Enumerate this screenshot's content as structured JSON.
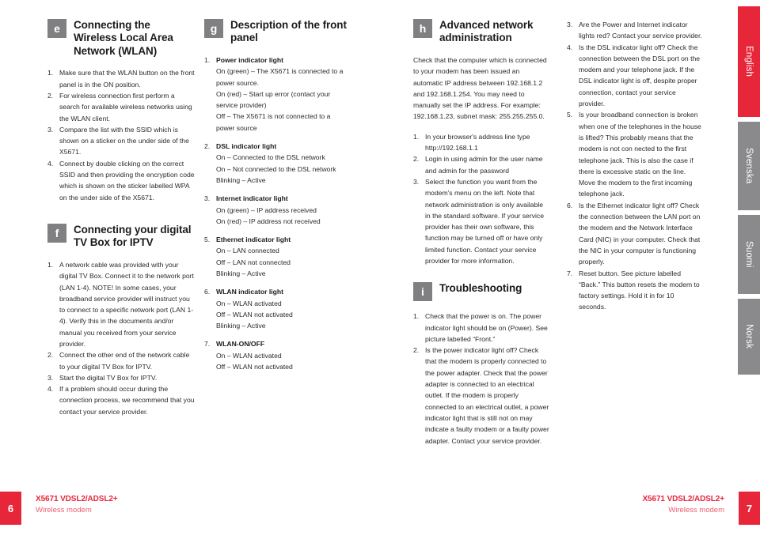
{
  "document": {
    "product": "X5671 VDSL2/ADSL2+",
    "product_subtitle": "Wireless modem",
    "accent_red": "#e8263a",
    "badge_gray": "#808083"
  },
  "language_tabs": [
    {
      "label": "English",
      "active": true
    },
    {
      "label": "Svenska",
      "active": false
    },
    {
      "label": "Suomi",
      "active": false
    },
    {
      "label": "Norsk",
      "active": false
    }
  ],
  "footer_left": {
    "page": "6",
    "product": "X5671 VDSL2/ADSL2+",
    "subtitle": "Wireless modem"
  },
  "footer_right": {
    "page": "7",
    "product": "X5671 VDSL2/ADSL2+",
    "subtitle": "Wireless modem"
  },
  "column1": {
    "section_e": {
      "badge": "e",
      "title": "Connecting the Wireless Local Area Network (WLAN)",
      "items": [
        {
          "num": "1.",
          "text": "Make sure that the WLAN button on the front panel is in the ON position."
        },
        {
          "num": "2.",
          "text": "For wireless connection first perform a search for available wireless networks using the WLAN client."
        },
        {
          "num": "3.",
          "text": "Compare the list with the SSID which is shown on a sticker on the under side of the X5671."
        },
        {
          "num": "4.",
          "text": "Connect by double clicking on the correct SSID and then providing the encryption code which is shown on the sticker labelled WPA on the under side of the X5671."
        }
      ]
    },
    "section_f": {
      "badge": "f",
      "title": "Connecting your digital TV Box for IPTV",
      "items": [
        {
          "num": "1.",
          "text": "A network cable was provided with your digital TV Box. Connect it to the network port (LAN 1-4). NOTE! In some cases, your broadband service provider will instruct you to connect to a specific network port (LAN 1-4). Verify this in the documents and/or manual you received from your service provider."
        },
        {
          "num": "2.",
          "text": "Connect the other end of the network cable to your digital TV Box for IPTV."
        },
        {
          "num": "3.",
          "text": "Start the digital TV Box for IPTV."
        },
        {
          "num": "4.",
          "text": "If a problem should occur during the connection process, we recommend that you contact your service provider."
        }
      ]
    }
  },
  "column2": {
    "section_g": {
      "badge": "g",
      "title": "Description of the front panel",
      "items": [
        {
          "num": "1.",
          "title": "Power indicator light",
          "lines": [
            "On (green) – The X5671 is connected to a power source.",
            "On (red) – Start up error (contact your service provider)",
            "Off – The X5671 is not connected to a power source"
          ]
        },
        {
          "num": "2.",
          "title": "DSL indicator light",
          "lines": [
            "On – Connected to the DSL network",
            "On – Not connected to the DSL network",
            "Blinking – Active"
          ]
        },
        {
          "num": "3.",
          "title": "Internet indicator light",
          "lines": [
            "On (green) – IP address received",
            "On (red) – IP address not received"
          ]
        },
        {
          "num": "5.",
          "title": "Ethernet indicator light",
          "lines": [
            "On – LAN connected",
            "Off – LAN not connected",
            "Blinking – Active"
          ]
        },
        {
          "num": "6.",
          "title": "WLAN indicator light",
          "lines": [
            "On – WLAN activated",
            "Off – WLAN not activated",
            "Blinking – Active"
          ]
        },
        {
          "num": "7.",
          "title": "WLAN-ON/OFF",
          "lines": [
            "On – WLAN activated",
            "Off – WLAN not activated"
          ]
        }
      ]
    }
  },
  "column3": {
    "section_h": {
      "badge": "h",
      "title": "Advanced network administration",
      "intro": "Check that the computer which is connected to your modem has been issued an automatic IP address between 192.168.1.2 and 192.168.1.254. You may need to manually set the IP address. For example: 192.168.1.23, subnet mask: 255.255.255.0.",
      "items": [
        {
          "num": "1.",
          "text": "In your browser's address line type http://192.168.1.1"
        },
        {
          "num": "2.",
          "text": "Login in using admin for the user name and admin for the password"
        },
        {
          "num": "3.",
          "text": "Select the function you want from the modem's menu on the left. Note that network administration is only available in the standard software. If your service provider has their own software, this function may be turned off or have only limited function. Contact your service provider for more information."
        }
      ]
    },
    "section_i": {
      "badge": "i",
      "title": "Troubleshooting",
      "items": [
        {
          "num": "1.",
          "text": "Check that the power is on. The power indicator light should be on (Power). See picture labelled “Front.”"
        },
        {
          "num": "2.",
          "text": "Is the power indicator light off? Check that the modem is properly connected to the power adapter.  Check that the power adapter is connected to an electrical outlet. If the modem is properly connected to an electrical outlet, a power indicator light that is still not on may indicate a faulty modem or a faulty power adapter. Contact your service provider."
        }
      ]
    }
  },
  "column4": {
    "troubleshooting_continued": [
      {
        "num": "3.",
        "text": "Are the Power and Internet indicator lights red? Contact your service provider."
      },
      {
        "num": "4.",
        "text": "Is the DSL indicator light off? Check the connection between the DSL port on the modem and your telephone jack. If the DSL indicator light is off, despite proper connection, contact your service provider."
      },
      {
        "num": "5.",
        "text": "Is your broadband connection is broken when one of the telephones in the house is lifted? This probably means that the modem is not con nected to the first telephone jack. This is also the case if there is excessive static on the line. Move the modem to the first incoming telephone jack."
      },
      {
        "num": "6.",
        "text": "Is the Ethernet indicator light off? Check the connection between the LAN port on the modem and the Network Interface Card (NIC) in your computer. Check that the NIC in your computer is functioning properly."
      },
      {
        "num": "7.",
        "text": "Reset button. See picture labelled “Back.” This button resets the modem to factory settings. Hold it in for 10 seconds."
      }
    ]
  }
}
